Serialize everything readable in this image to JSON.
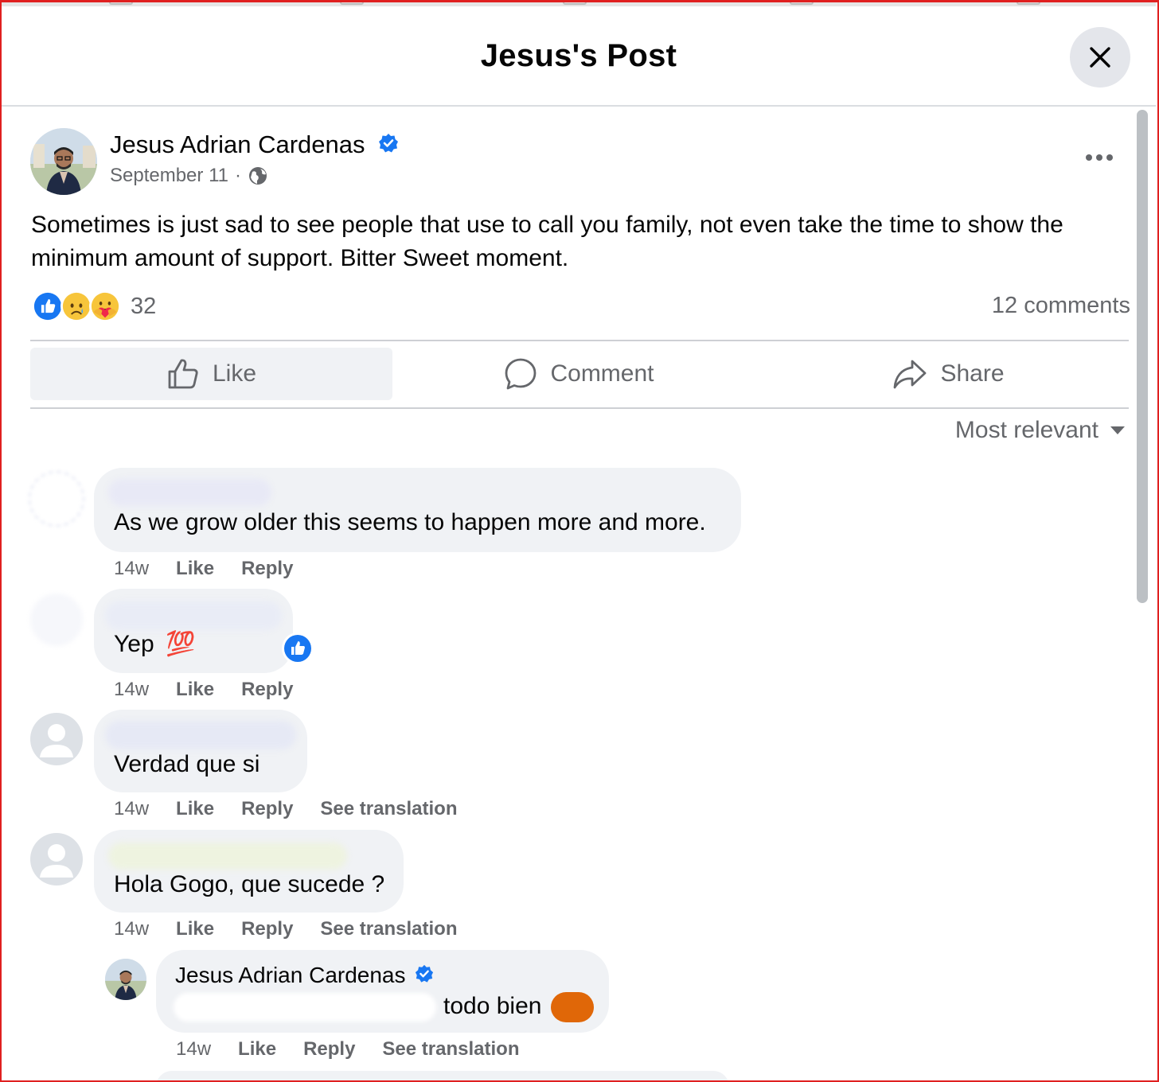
{
  "header": {
    "title": "Jesus's Post"
  },
  "post": {
    "author": "Jesus Adrian Cardenas",
    "date": "September 11",
    "separator": "·",
    "text": "Sometimes is just sad to see people that use to call you family, not even take the time to show the minimum amount of support. Bitter Sweet moment.",
    "reaction_count": "32",
    "reaction_icons": [
      "like-icon",
      "sad-icon",
      "care-icon"
    ],
    "comment_count": "12 comments"
  },
  "actions": {
    "like": "Like",
    "comment": "Comment",
    "share": "Share"
  },
  "sort": {
    "label": "Most relevant"
  },
  "comments": [
    {
      "text": "As we grow older this seems to happen more and more.",
      "time": "14w",
      "like": "Like",
      "reply": "Reply"
    },
    {
      "text": "Yep",
      "emoji": "💯",
      "time": "14w",
      "like": "Like",
      "reply": "Reply",
      "reacted": "like-icon"
    },
    {
      "text": "Verdad que si",
      "time": "14w",
      "like": "Like",
      "reply": "Reply",
      "translate": "See translation"
    },
    {
      "text": "Hola Gogo, que sucede ?",
      "time": "14w",
      "like": "Like",
      "reply": "Reply",
      "translate": "See translation"
    },
    {
      "author": "Jesus Adrian Cardenas",
      "text": "todo bien",
      "time": "14w",
      "like": "Like",
      "reply": "Reply",
      "translate": "See translation"
    }
  ],
  "colors": {
    "brand": "#1877f2",
    "muted": "#65676b",
    "bubble": "#f0f2f5",
    "frame": "#e02020"
  }
}
